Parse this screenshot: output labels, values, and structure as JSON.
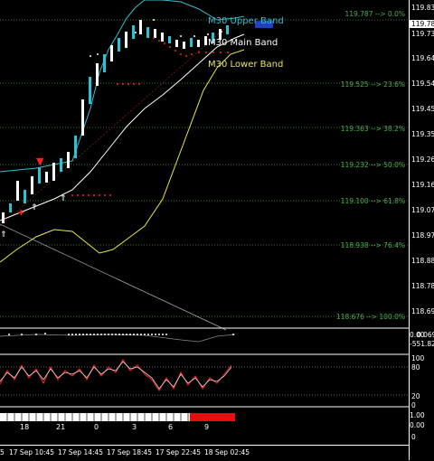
{
  "price_axis": [
    "119.830",
    "119.782",
    "119.735",
    "119.640",
    "119.545",
    "119.450",
    "119.355",
    "119.260",
    "119.165",
    "119.070",
    "118.975",
    "118.880",
    "118.785",
    "118.690"
  ],
  "fib_levels": [
    {
      "label": "119.787 --> 0.0%"
    },
    {
      "label": "119.525 --> 23.6%"
    },
    {
      "label": "119.363 --> 38.2%"
    },
    {
      "label": "119.232 --> 50.0%"
    },
    {
      "label": "119.100 --> 61.8%"
    },
    {
      "label": "118.938 --> 76.4%"
    },
    {
      "label": "118.676 --> 100.0%"
    }
  ],
  "bands": {
    "upper": "M30 Upper Band",
    "main": "M30 Main Band",
    "lower": "M30 Lower Band"
  },
  "subwindow1_axis": [
    "0.00",
    "-551.829",
    "0.0693"
  ],
  "subwindow2_axis": [
    "100",
    "80",
    "20",
    "0"
  ],
  "subwindow3_axis": [
    "1.00",
    "0.00",
    "0"
  ],
  "subwindow3_numbers": [
    "18",
    "21",
    "0",
    "3",
    "6",
    "9"
  ],
  "time_axis": [
    "5",
    "17 Sep 10:45",
    "17 Sep 14:45",
    "17 Sep 18:45",
    "17 Sep 22:45",
    "18 Sep 02:45"
  ],
  "colors": {
    "upper_band": "#33bfcf",
    "main_band": "#ffffff",
    "lower_band": "#e8e84a",
    "fib": "#4caf50",
    "signal": "#ff2020",
    "highlight_box": "#2040c0"
  }
}
